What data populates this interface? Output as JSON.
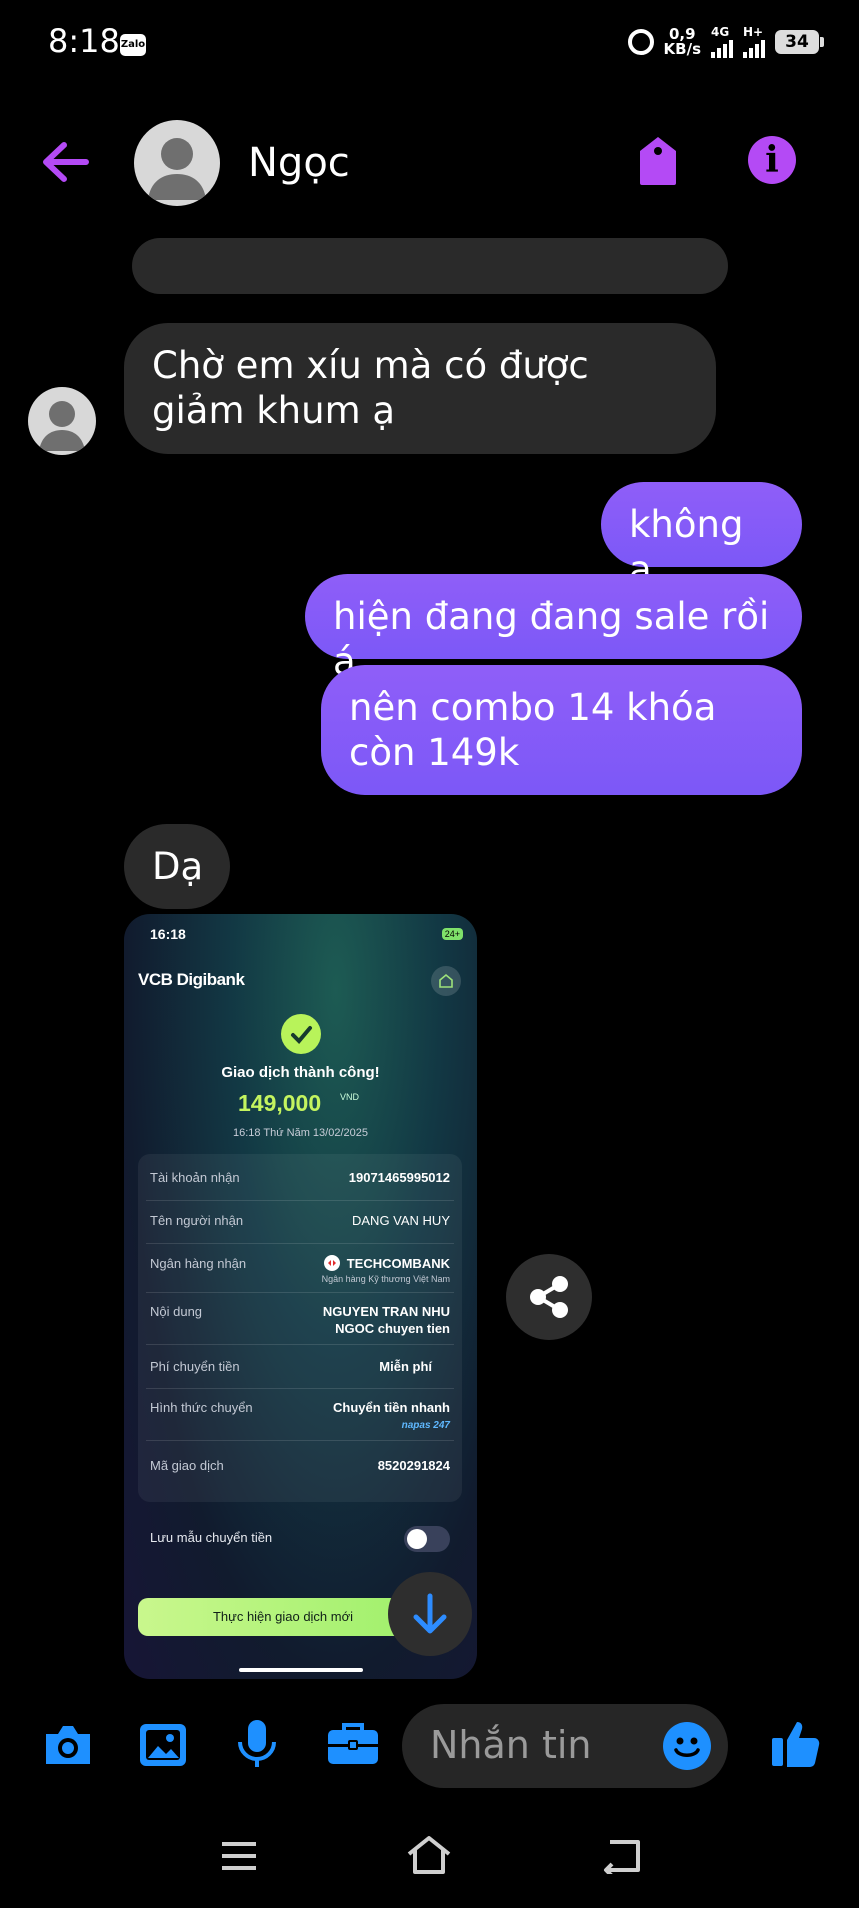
{
  "status_bar": {
    "time": "8:18",
    "app_badge": "Zalo",
    "speed_value": "0,9",
    "speed_unit": "KB/s",
    "net1": "4G",
    "net2": "H+",
    "battery": "34"
  },
  "header": {
    "contact_name": "Ngọc",
    "accent_color": "#b44af5"
  },
  "messages": [
    {
      "from": "them",
      "text": "Chờ em xíu mà có được giảm khum ạ"
    },
    {
      "from": "me",
      "text": "không ạ"
    },
    {
      "from": "me",
      "text": "hiện đang đang sale rồi á"
    },
    {
      "from": "me",
      "text": "nên combo 14 khóa còn 149k"
    },
    {
      "from": "them",
      "text": "Dạ"
    }
  ],
  "receipt": {
    "time": "16:18",
    "signal": "24+",
    "bank": "VCB Digibank",
    "status": "Giao dịch thành công!",
    "amount": "149,000",
    "currency": "VND",
    "datetime": "16:18 Thứ Năm 13/02/2025",
    "rows": [
      {
        "label": "Tài khoản nhận",
        "value": "19071465995012"
      },
      {
        "label": "Tên người nhận",
        "value": "DANG VAN HUY"
      },
      {
        "label": "Ngân hàng nhận",
        "value": "TECHCOMBANK",
        "sub": "Ngân hàng Kỹ thương Việt Nam"
      },
      {
        "label": "Nội dung",
        "value": "NGUYEN TRAN NHU",
        "value2": "NGOC chuyen tien"
      },
      {
        "label": "Phí chuyển tiền",
        "value": "Miễn phí"
      },
      {
        "label": "Hình thức chuyển",
        "value": "Chuyển tiền nhanh",
        "sub": "napas 247"
      },
      {
        "label": "Mã giao dịch",
        "value": "8520291824"
      }
    ],
    "save_template": "Lưu mẫu chuyển tiền",
    "new_transaction": "Thực hiện giao dịch mới"
  },
  "composer": {
    "placeholder": "Nhắn tin",
    "accent_color": "#1e90ff"
  }
}
